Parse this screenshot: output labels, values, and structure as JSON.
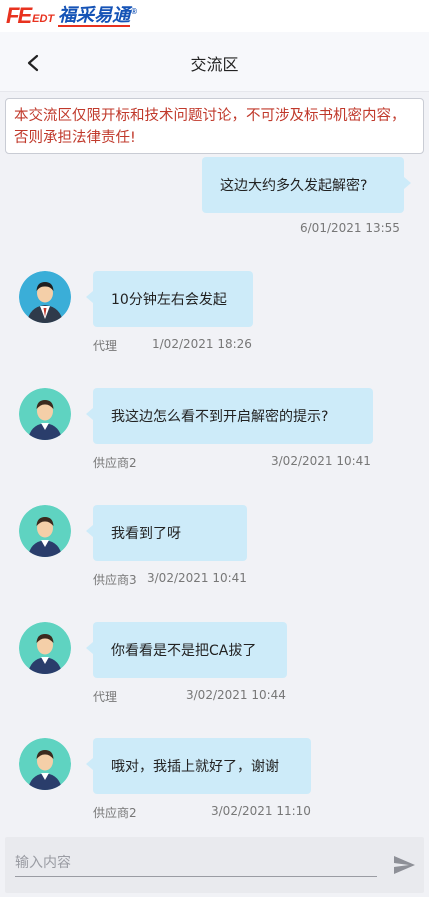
{
  "logo": {
    "mark": "FE",
    "edt": "EDT",
    "cn": "福采易通",
    "reg": "®"
  },
  "header": {
    "title": "交流区"
  },
  "notice": {
    "text": "本交流区仅限开标和技术问题讨论，不可涉及标书机密内容，否则承担法律责任!"
  },
  "messages": [
    {
      "side": "right",
      "text": "这边大约多久发起解密?",
      "sender": "",
      "time": "6/01/2021 13:55"
    },
    {
      "side": "left",
      "avatar": "agent-suit-avatar-icon",
      "text": "10分钟左右会发起",
      "sender": "代理",
      "time": "1/02/2021 18:26"
    },
    {
      "side": "left",
      "avatar": "supplier-avatar-icon",
      "text": "我这边怎么看不到开启解密的提示?",
      "sender": "供应商2",
      "time": "3/02/2021 10:41"
    },
    {
      "side": "left",
      "avatar": "supplier-avatar-icon",
      "text": "我看到了呀",
      "sender": "供应商3",
      "time": "3/02/2021 10:41"
    },
    {
      "side": "left",
      "avatar": "supplier-avatar-icon",
      "text": "你看看是不是把CA拔了",
      "sender": "代理",
      "time": "3/02/2021 10:44"
    },
    {
      "side": "left",
      "avatar": "supplier-avatar-icon",
      "text": "哦对，我插上就好了，谢谢",
      "sender": "供应商2",
      "time": "3/02/2021 11:10"
    }
  ],
  "input": {
    "placeholder": "输入内容",
    "value": ""
  },
  "icons": {
    "back": "chevron-left-icon",
    "send": "send-icon"
  },
  "colors": {
    "bubble": "#cdebf9",
    "notice_text": "#c0392b",
    "logo_red": "#e8321f",
    "logo_blue": "#1553b6"
  }
}
